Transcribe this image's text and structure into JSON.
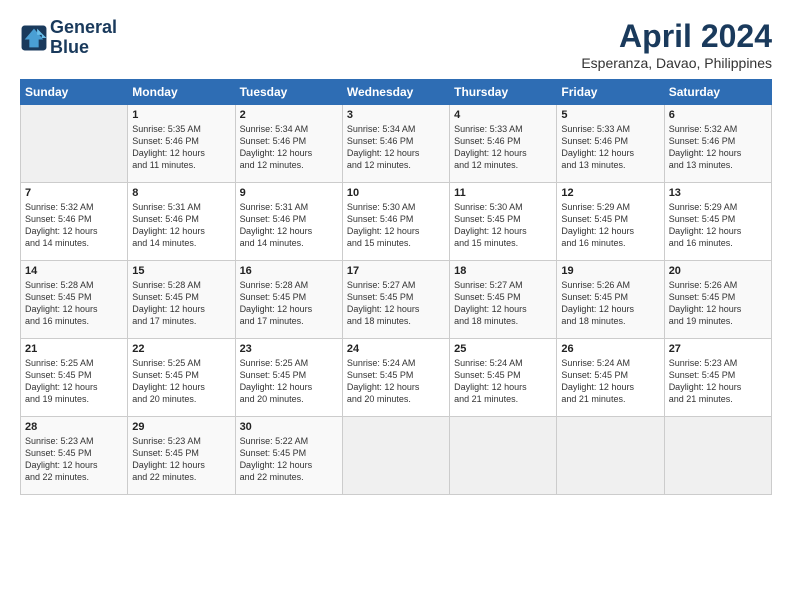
{
  "logo": {
    "line1": "General",
    "line2": "Blue"
  },
  "title": "April 2024",
  "location": "Esperanza, Davao, Philippines",
  "days_header": [
    "Sunday",
    "Monday",
    "Tuesday",
    "Wednesday",
    "Thursday",
    "Friday",
    "Saturday"
  ],
  "weeks": [
    [
      {
        "num": "",
        "info": ""
      },
      {
        "num": "1",
        "info": "Sunrise: 5:35 AM\nSunset: 5:46 PM\nDaylight: 12 hours\nand 11 minutes."
      },
      {
        "num": "2",
        "info": "Sunrise: 5:34 AM\nSunset: 5:46 PM\nDaylight: 12 hours\nand 12 minutes."
      },
      {
        "num": "3",
        "info": "Sunrise: 5:34 AM\nSunset: 5:46 PM\nDaylight: 12 hours\nand 12 minutes."
      },
      {
        "num": "4",
        "info": "Sunrise: 5:33 AM\nSunset: 5:46 PM\nDaylight: 12 hours\nand 12 minutes."
      },
      {
        "num": "5",
        "info": "Sunrise: 5:33 AM\nSunset: 5:46 PM\nDaylight: 12 hours\nand 13 minutes."
      },
      {
        "num": "6",
        "info": "Sunrise: 5:32 AM\nSunset: 5:46 PM\nDaylight: 12 hours\nand 13 minutes."
      }
    ],
    [
      {
        "num": "7",
        "info": "Sunrise: 5:32 AM\nSunset: 5:46 PM\nDaylight: 12 hours\nand 14 minutes."
      },
      {
        "num": "8",
        "info": "Sunrise: 5:31 AM\nSunset: 5:46 PM\nDaylight: 12 hours\nand 14 minutes."
      },
      {
        "num": "9",
        "info": "Sunrise: 5:31 AM\nSunset: 5:46 PM\nDaylight: 12 hours\nand 14 minutes."
      },
      {
        "num": "10",
        "info": "Sunrise: 5:30 AM\nSunset: 5:46 PM\nDaylight: 12 hours\nand 15 minutes."
      },
      {
        "num": "11",
        "info": "Sunrise: 5:30 AM\nSunset: 5:45 PM\nDaylight: 12 hours\nand 15 minutes."
      },
      {
        "num": "12",
        "info": "Sunrise: 5:29 AM\nSunset: 5:45 PM\nDaylight: 12 hours\nand 16 minutes."
      },
      {
        "num": "13",
        "info": "Sunrise: 5:29 AM\nSunset: 5:45 PM\nDaylight: 12 hours\nand 16 minutes."
      }
    ],
    [
      {
        "num": "14",
        "info": "Sunrise: 5:28 AM\nSunset: 5:45 PM\nDaylight: 12 hours\nand 16 minutes."
      },
      {
        "num": "15",
        "info": "Sunrise: 5:28 AM\nSunset: 5:45 PM\nDaylight: 12 hours\nand 17 minutes."
      },
      {
        "num": "16",
        "info": "Sunrise: 5:28 AM\nSunset: 5:45 PM\nDaylight: 12 hours\nand 17 minutes."
      },
      {
        "num": "17",
        "info": "Sunrise: 5:27 AM\nSunset: 5:45 PM\nDaylight: 12 hours\nand 18 minutes."
      },
      {
        "num": "18",
        "info": "Sunrise: 5:27 AM\nSunset: 5:45 PM\nDaylight: 12 hours\nand 18 minutes."
      },
      {
        "num": "19",
        "info": "Sunrise: 5:26 AM\nSunset: 5:45 PM\nDaylight: 12 hours\nand 18 minutes."
      },
      {
        "num": "20",
        "info": "Sunrise: 5:26 AM\nSunset: 5:45 PM\nDaylight: 12 hours\nand 19 minutes."
      }
    ],
    [
      {
        "num": "21",
        "info": "Sunrise: 5:25 AM\nSunset: 5:45 PM\nDaylight: 12 hours\nand 19 minutes."
      },
      {
        "num": "22",
        "info": "Sunrise: 5:25 AM\nSunset: 5:45 PM\nDaylight: 12 hours\nand 20 minutes."
      },
      {
        "num": "23",
        "info": "Sunrise: 5:25 AM\nSunset: 5:45 PM\nDaylight: 12 hours\nand 20 minutes."
      },
      {
        "num": "24",
        "info": "Sunrise: 5:24 AM\nSunset: 5:45 PM\nDaylight: 12 hours\nand 20 minutes."
      },
      {
        "num": "25",
        "info": "Sunrise: 5:24 AM\nSunset: 5:45 PM\nDaylight: 12 hours\nand 21 minutes."
      },
      {
        "num": "26",
        "info": "Sunrise: 5:24 AM\nSunset: 5:45 PM\nDaylight: 12 hours\nand 21 minutes."
      },
      {
        "num": "27",
        "info": "Sunrise: 5:23 AM\nSunset: 5:45 PM\nDaylight: 12 hours\nand 21 minutes."
      }
    ],
    [
      {
        "num": "28",
        "info": "Sunrise: 5:23 AM\nSunset: 5:45 PM\nDaylight: 12 hours\nand 22 minutes."
      },
      {
        "num": "29",
        "info": "Sunrise: 5:23 AM\nSunset: 5:45 PM\nDaylight: 12 hours\nand 22 minutes."
      },
      {
        "num": "30",
        "info": "Sunrise: 5:22 AM\nSunset: 5:45 PM\nDaylight: 12 hours\nand 22 minutes."
      },
      {
        "num": "",
        "info": ""
      },
      {
        "num": "",
        "info": ""
      },
      {
        "num": "",
        "info": ""
      },
      {
        "num": "",
        "info": ""
      }
    ]
  ]
}
